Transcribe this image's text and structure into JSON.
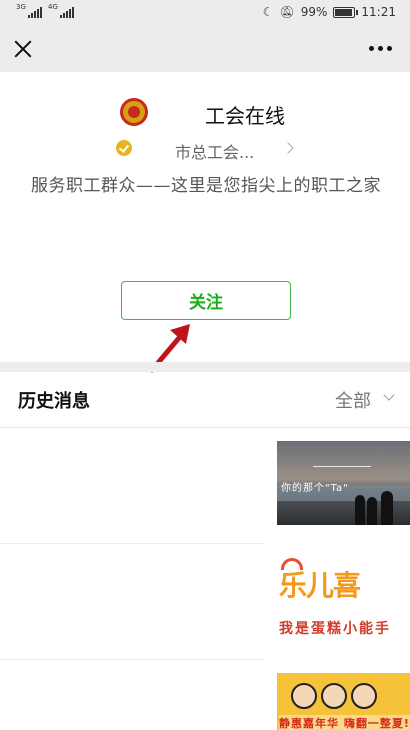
{
  "status_bar": {
    "net1": "3G",
    "net2": "4G",
    "battery_percent": "99%",
    "battery_level": 0.99,
    "time": "11:21",
    "icons": [
      "moon-icon",
      "mute-icon",
      "battery-icon"
    ]
  },
  "profile": {
    "account_name": "工会在线",
    "org_name": "市总工会...",
    "description": "服务职工群众——这里是您指尖上的职工之家",
    "follow_label": "关注"
  },
  "history": {
    "title": "历史消息",
    "filter_label": "全部"
  },
  "articles": [
    {
      "thumb_caption": "你的那个\"Ta\""
    },
    {
      "thumb_title": "乐儿喜",
      "thumb_subtitle": "我是蛋糕小能手"
    },
    {
      "thumb_caption": "静惠嘉年华 嗨翻一整夏!"
    }
  ],
  "colors": {
    "accent_green": "#1aad19",
    "arrow_red": "#c0141c",
    "header_bg": "#ececec"
  }
}
